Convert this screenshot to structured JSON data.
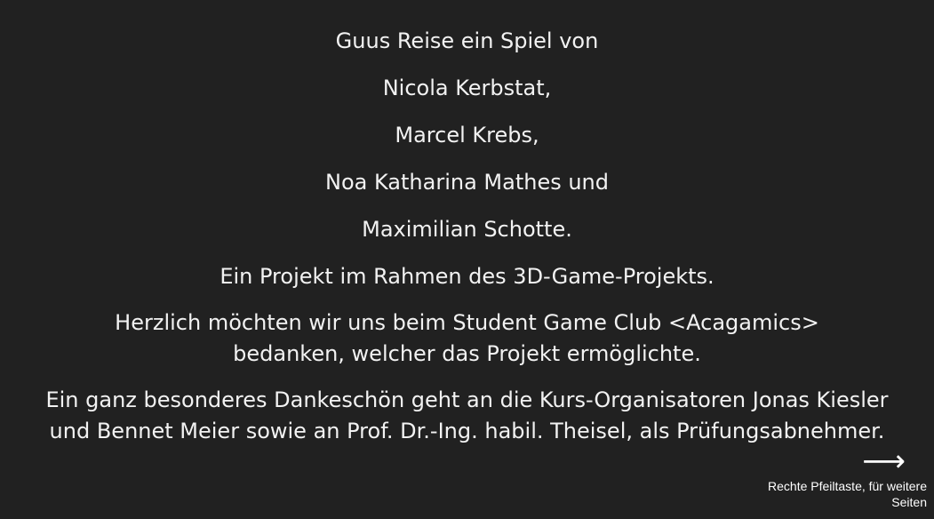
{
  "credits": {
    "title": "Guus Reise ein Spiel von",
    "authors": [
      "Nicola Kerbstat,",
      "Marcel Krebs,",
      "Noa Katharina Mathes und",
      "Maximilian Schotte."
    ],
    "project_note": "Ein Projekt im Rahmen des 3D-Game-Projekts.",
    "thanks_club": "Herzlich möchten wir uns beim Student Game Club <Acagamics> bedanken, welcher das Projekt ermöglichte.",
    "thanks_organizers": "Ein ganz besonderes Dankeschön geht an die Kurs-Organisatoren Jonas Kiesler und Bennet Meier sowie an Prof. Dr.-Ing. habil. Theisel, als Prüfungsabnehmer."
  },
  "navigation": {
    "arrow_icon": "right-arrow-icon",
    "arrow_glyph": "⟶",
    "hint": "Rechte Pfeiltaste, für weitere Seiten"
  }
}
